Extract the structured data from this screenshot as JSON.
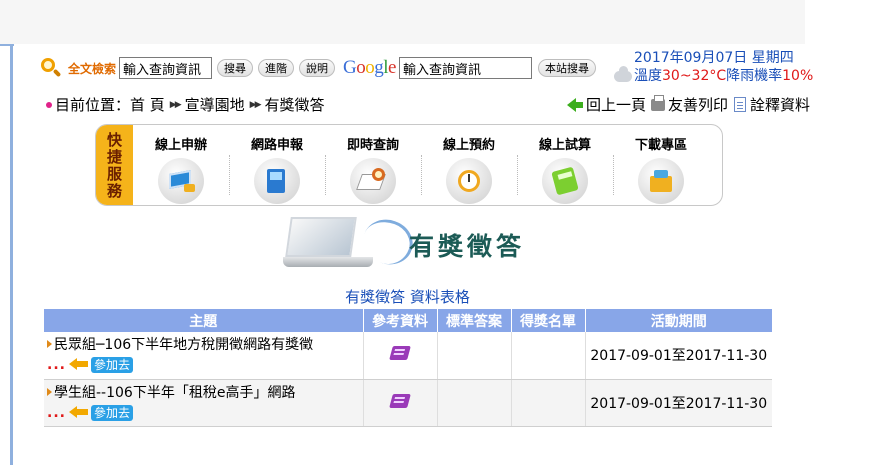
{
  "search": {
    "label": "全文檢索",
    "input_value": "輸入查詢資訊",
    "btn_search": "搜尋",
    "btn_advanced": "進階",
    "btn_help": "說明",
    "google_input_value": "輸入查詢資訊",
    "btn_site_search": "本站搜尋"
  },
  "date_weather": {
    "date": "2017年09月07日 星期四",
    "temp_label": "溫度",
    "temp_value": "30~32°C",
    "rain_label": " 降雨機率",
    "rain_value": "10%"
  },
  "breadcrumb": {
    "prefix": "目前位置：",
    "items": [
      "首 頁",
      "宣導園地",
      "有獎徵答"
    ]
  },
  "tools": {
    "back": "回上一頁",
    "print": "友善列印",
    "glossary": "詮釋資料"
  },
  "quick_services": {
    "tag_lines": [
      "快",
      "捷",
      "服",
      "務"
    ],
    "items": [
      {
        "label": "線上申辦",
        "icon": "monitor-apply-icon"
      },
      {
        "label": "網路申報",
        "icon": "computer-tower-icon"
      },
      {
        "label": "即時查詢",
        "icon": "document-search-icon"
      },
      {
        "label": "線上預約",
        "icon": "alarm-clock-icon"
      },
      {
        "label": "線上試算",
        "icon": "calculator-icon"
      },
      {
        "label": "下載專區",
        "icon": "download-box-icon"
      }
    ]
  },
  "banner": {
    "title": "有獎徵答"
  },
  "table": {
    "caption": "有獎徵答 資料表格",
    "headers": [
      "主題",
      "參考資料",
      "標準答案",
      "得獎名單",
      "活動期間"
    ],
    "rows": [
      {
        "topic": "民眾組─106下半年地方稅開徵網路有獎徵",
        "join": "參加去",
        "period": "2017-09-01至2017-11-30"
      },
      {
        "topic": "學生組--106下半年「租稅e高手」網路",
        "join": "參加去",
        "period": "2017-09-01至2017-11-30"
      }
    ]
  },
  "colors": {
    "accent_blue": "#1a4fb8",
    "header_blue": "#88a6e8",
    "quick_tag": "#f5b31a",
    "alert_red": "#e01818"
  }
}
